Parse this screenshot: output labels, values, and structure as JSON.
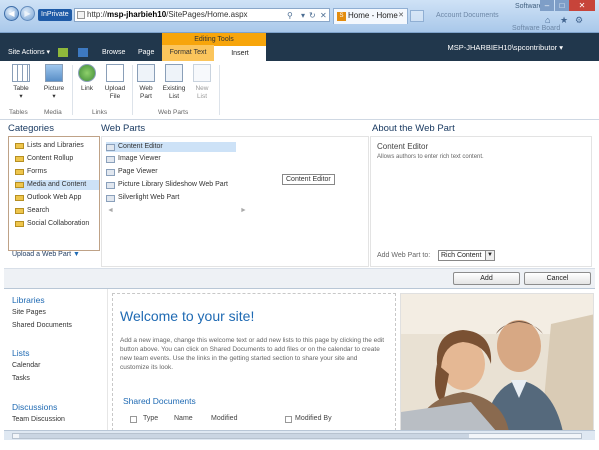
{
  "browser": {
    "inprivate": "InPrivate",
    "url_prefix": "http://",
    "url_host": "msp-jharbieh10",
    "url_path": "/SitePages/Home.aspx",
    "tab_title": "Home - Home",
    "ghost_tabs": [
      "Account Documents",
      "Software Board"
    ],
    "window_caption": "Software"
  },
  "ribbon": {
    "site_actions": "Site Actions",
    "tabs": [
      "Browse",
      "Page",
      "Format Text",
      "Insert"
    ],
    "contextual_group": "Editing Tools",
    "user": "MSP-JHARBIEH10\\spcontributor",
    "buttons": [
      {
        "label": "Table"
      },
      {
        "label": "Picture"
      },
      {
        "label": "Link"
      },
      {
        "label": "Upload File"
      },
      {
        "label": "Web Part"
      },
      {
        "label": "Existing List"
      },
      {
        "label": "New List"
      }
    ],
    "groups": [
      "Tables",
      "Media",
      "Links",
      "Web Parts"
    ]
  },
  "adder": {
    "categories_title": "Categories",
    "webparts_title": "Web Parts",
    "about_title": "About the Web Part",
    "categories": [
      "Lists and Libraries",
      "Content Rollup",
      "Forms",
      "Media and Content",
      "Outlook Web App",
      "Search",
      "Social Collaboration"
    ],
    "upload": "Upload a Web Part",
    "web_parts": [
      "Content Editor",
      "Image Viewer",
      "Page Viewer",
      "Picture Library Slideshow Web Part",
      "Silverlight Web Part"
    ],
    "tooltip": "Content Editor",
    "about_name": "Content Editor",
    "about_desc": "Allows authors to enter rich text content.",
    "add_to_label": "Add Web Part to:",
    "add_to_value": "Rich Content",
    "add_button": "Add",
    "cancel_button": "Cancel"
  },
  "page": {
    "nav": [
      {
        "heading": "Libraries",
        "items": [
          "Site Pages",
          "Shared Documents"
        ]
      },
      {
        "heading": "Lists",
        "items": [
          "Calendar",
          "Tasks"
        ]
      },
      {
        "heading": "Discussions",
        "items": [
          "Team Discussion"
        ]
      }
    ],
    "welcome": "Welcome to your site!",
    "intro": "Add a new image, change this welcome text or add new lists to this page by clicking the edit button above. You can click on Shared Documents to add files or on the calendar to create new team events. Use the links in the getting started section to share your site and customize its look.",
    "shared_docs": "Shared Documents",
    "columns": [
      "Type",
      "Name",
      "Modified",
      "Modified By"
    ]
  },
  "colors": {
    "ribbon_dark": "#21374c",
    "editing_tools": "#f7a50b",
    "link_blue": "#1f6ab3"
  }
}
